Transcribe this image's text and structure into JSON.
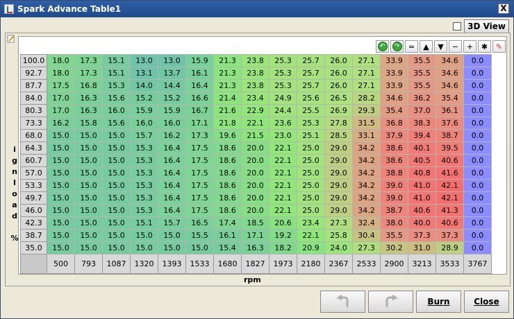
{
  "window": {
    "title": "Spark Advance Table1",
    "close_glyph": "X"
  },
  "toolbar": {
    "view3d_label": "3D View",
    "view3d_checked": false
  },
  "icons": [
    "undo-green-icon",
    "redo-green-icon",
    "equals-icon",
    "increment-up-icon",
    "decrement-down-icon",
    "minus-icon",
    "plus-icon",
    "multiply-icon",
    "color-edit-icon"
  ],
  "icon_glyphs": [
    "↶",
    "↷",
    "=",
    "▲",
    "▼",
    "−",
    "+",
    "✱",
    "✎"
  ],
  "axes": {
    "y_label": "ignload %",
    "x_label": "rpm"
  },
  "y_axis": [
    "100.0",
    "92.7",
    "87.7",
    "84.0",
    "80.3",
    "73.3",
    "68.0",
    "64.3",
    "60.7",
    "57.0",
    "53.3",
    "49.7",
    "46.0",
    "42.3",
    "38.7",
    "35.0"
  ],
  "x_axis": [
    "500",
    "793",
    "1087",
    "1320",
    "1393",
    "1533",
    "1680",
    "1827",
    "1973",
    "2180",
    "2367",
    "2533",
    "2900",
    "3213",
    "3533",
    "3767"
  ],
  "grid": [
    [
      "18.0",
      "17.3",
      "15.1",
      "13.0",
      "13.0",
      "15.9",
      "21.3",
      "23.8",
      "25.3",
      "25.7",
      "26.0",
      "27.1",
      "33.9",
      "35.5",
      "34.6",
      "0.0"
    ],
    [
      "18.0",
      "17.3",
      "15.1",
      "13.1",
      "13.7",
      "16.1",
      "21.3",
      "23.8",
      "25.3",
      "25.7",
      "26.0",
      "27.1",
      "33.9",
      "35.5",
      "34.6",
      "0.0"
    ],
    [
      "17.5",
      "16.8",
      "15.3",
      "14.0",
      "14.4",
      "16.4",
      "21.3",
      "23.8",
      "25.3",
      "25.7",
      "26.0",
      "27.1",
      "33.9",
      "35.5",
      "34.6",
      "0.0"
    ],
    [
      "17.0",
      "16.3",
      "15.6",
      "15.2",
      "15.2",
      "16.6",
      "21.4",
      "23.4",
      "24.9",
      "25.6",
      "26.5",
      "28.2",
      "34.6",
      "36.2",
      "35.4",
      "0.0"
    ],
    [
      "17.0",
      "16.3",
      "16.0",
      "15.9",
      "15.9",
      "16.7",
      "21.6",
      "22.9",
      "24.4",
      "25.5",
      "26.9",
      "29.3",
      "35.4",
      "37.0",
      "36.1",
      "0.0"
    ],
    [
      "16.2",
      "15.8",
      "15.6",
      "16.0",
      "16.0",
      "17.1",
      "21.8",
      "22.1",
      "23.6",
      "25.3",
      "27.8",
      "31.5",
      "36.8",
      "38.3",
      "37.6",
      "0.0"
    ],
    [
      "15.0",
      "15.0",
      "15.0",
      "15.7",
      "16.2",
      "17.3",
      "19.6",
      "21.5",
      "23.0",
      "25.1",
      "28.5",
      "33.1",
      "37.9",
      "39.4",
      "38.7",
      "0.0"
    ],
    [
      "15.0",
      "15.0",
      "15.0",
      "15.3",
      "16.4",
      "17.5",
      "18.6",
      "20.0",
      "22.1",
      "25.0",
      "29.0",
      "34.2",
      "38.6",
      "40.1",
      "39.5",
      "0.0"
    ],
    [
      "15.0",
      "15.0",
      "15.0",
      "15.3",
      "16.4",
      "17.5",
      "18.6",
      "20.0",
      "22.1",
      "25.0",
      "29.0",
      "34.2",
      "38.6",
      "40.5",
      "40.6",
      "0.0"
    ],
    [
      "15.0",
      "15.0",
      "15.0",
      "15.3",
      "16.4",
      "17.5",
      "18.6",
      "20.0",
      "22.1",
      "25.0",
      "29.0",
      "34.2",
      "38.8",
      "40.8",
      "41.6",
      "0.0"
    ],
    [
      "15.0",
      "15.0",
      "15.0",
      "15.3",
      "16.4",
      "17.5",
      "18.6",
      "20.0",
      "22.1",
      "25.0",
      "29.0",
      "34.2",
      "39.0",
      "41.0",
      "42.1",
      "0.0"
    ],
    [
      "15.0",
      "15.0",
      "15.0",
      "15.3",
      "16.4",
      "17.5",
      "18.6",
      "20.0",
      "22.1",
      "25.0",
      "29.0",
      "34.2",
      "39.0",
      "41.0",
      "42.1",
      "0.0"
    ],
    [
      "15.0",
      "15.0",
      "15.0",
      "15.3",
      "16.4",
      "17.5",
      "18.6",
      "20.0",
      "22.1",
      "25.0",
      "29.0",
      "34.2",
      "38.7",
      "40.6",
      "41.3",
      "0.0"
    ],
    [
      "15.0",
      "15.0",
      "15.0",
      "15.1",
      "15.7",
      "16.5",
      "17.4",
      "18.5",
      "20.6",
      "23.4",
      "27.3",
      "32.4",
      "38.0",
      "40.0",
      "40.6",
      "0.0"
    ],
    [
      "15.0",
      "15.0",
      "15.0",
      "15.0",
      "15.0",
      "15.5",
      "16.1",
      "17.1",
      "19.2",
      "22.1",
      "25.8",
      "30.4",
      "35.5",
      "37.3",
      "37.3",
      "0.0"
    ],
    [
      "15.0",
      "15.0",
      "15.0",
      "15.0",
      "15.0",
      "15.0",
      "15.4",
      "16.3",
      "18.2",
      "20.9",
      "24.0",
      "27.3",
      "30.2",
      "31.0",
      "28.9",
      "0.0"
    ]
  ],
  "buttons": {
    "undo_label": "",
    "redo_label": "",
    "burn_label": "Burn",
    "close_label": "Close"
  },
  "colors": {
    "zero_cell": "#8c8cff",
    "low": "#6cc8a0",
    "mid": "#8ce07a",
    "high": "#f07070"
  }
}
